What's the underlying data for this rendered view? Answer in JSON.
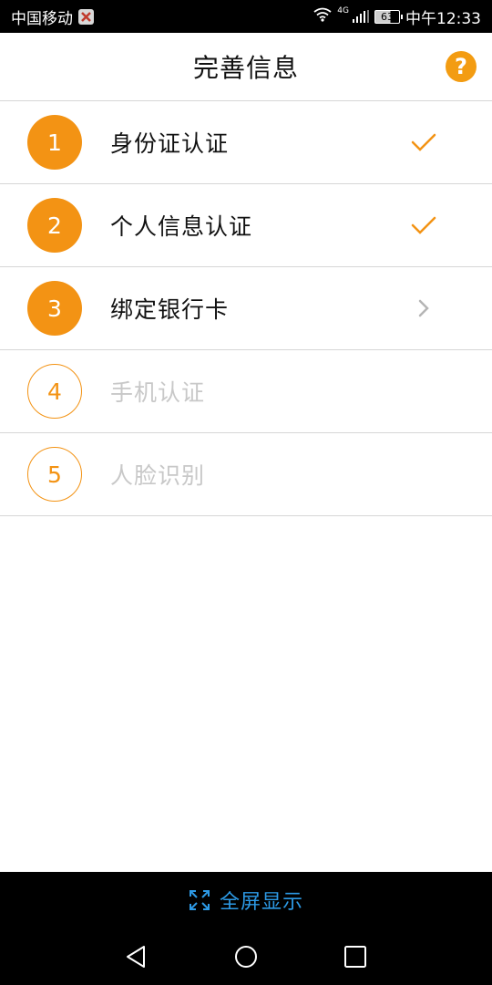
{
  "status_bar": {
    "carrier": "中国移动",
    "network": "4G",
    "battery": "63",
    "time": "中午12:33"
  },
  "header": {
    "title": "完善信息",
    "help_label": "?"
  },
  "steps": [
    {
      "number": "1",
      "label": "身份证认证",
      "state": "completed",
      "indicator": "check-icon"
    },
    {
      "number": "2",
      "label": "个人信息认证",
      "state": "completed",
      "indicator": "check-icon"
    },
    {
      "number": "3",
      "label": "绑定银行卡",
      "state": "current",
      "indicator": "chevron-right-icon"
    },
    {
      "number": "4",
      "label": "手机认证",
      "state": "locked",
      "indicator": ""
    },
    {
      "number": "5",
      "label": "人脸识别",
      "state": "locked",
      "indicator": ""
    }
  ],
  "bottom": {
    "fullscreen_label": "全屏显示"
  },
  "colors": {
    "accent": "#f39314",
    "link_blue": "#2d9ae6",
    "disabled_text": "#c8c8c8"
  }
}
